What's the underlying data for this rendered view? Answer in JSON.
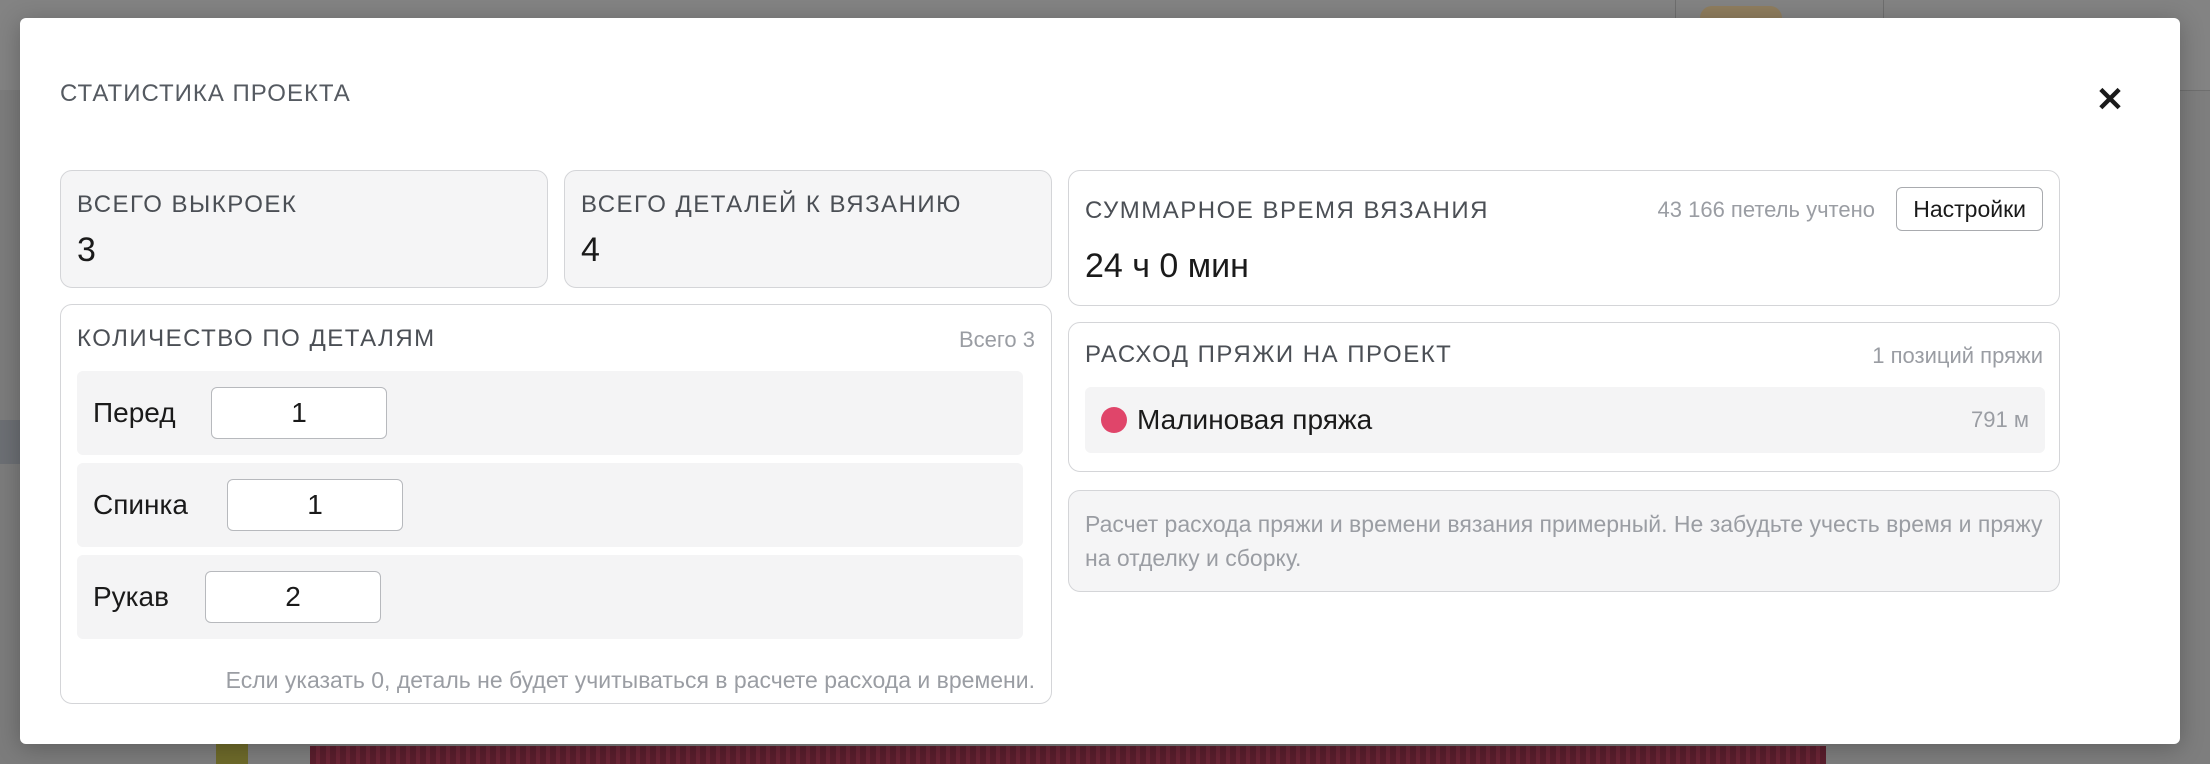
{
  "modal": {
    "title": "СТАТИСТИКА ПРОЕКТА",
    "close_icon": "close-icon",
    "close_glyph": "✕"
  },
  "stats": {
    "patterns_label": "ВСЕГО ВЫКРОЕК",
    "patterns_value": "3",
    "parts_label": "ВСЕГО ДЕТАЛЕЙ К ВЯЗАНИЮ",
    "parts_value": "4"
  },
  "time": {
    "label": "СУММАРНОЕ ВРЕМЯ ВЯЗАНИЯ",
    "stitches_counted": "43 166 петель учтено",
    "settings_label": "Настройки",
    "value": "24 ч 0 мин"
  },
  "quantity": {
    "label": "КОЛИЧЕСТВО ПО ДЕТАЛЯМ",
    "total": "Всего 3",
    "rows": [
      {
        "name": "Перед",
        "value": "1"
      },
      {
        "name": "Спинка",
        "value": "1"
      },
      {
        "name": "Рукав",
        "value": "2"
      }
    ],
    "hint": "Если указать 0, деталь не будет учитываться в расчете расхода и времени."
  },
  "yarn": {
    "label": "РАСХОД ПРЯЖИ НА ПРОЕКТ",
    "positions": "1 позиций пряжи",
    "items": [
      {
        "name": "Малиновая пряжа",
        "length": "791 м",
        "color": "#e0456a"
      }
    ]
  },
  "note": {
    "text": "Расчет расхода пряжи и времени вязания примерный. Не забудьте учесть время и пряжу на отделку и сборку."
  }
}
